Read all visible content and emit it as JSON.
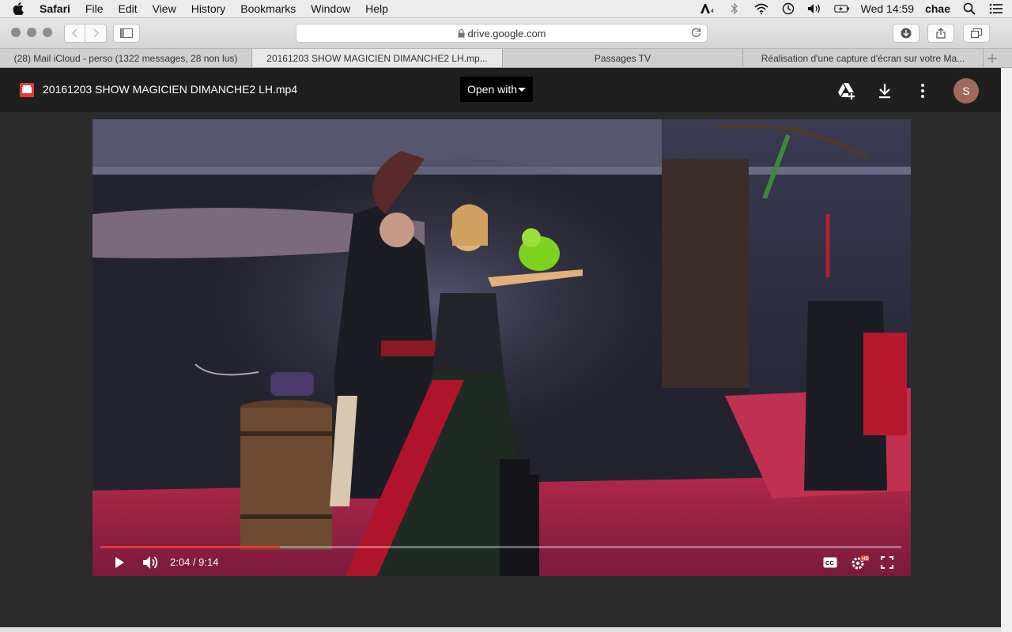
{
  "menubar": {
    "app": "Safari",
    "items": [
      "File",
      "Edit",
      "View",
      "History",
      "Bookmarks",
      "Window",
      "Help"
    ],
    "clock": "Wed 14:59",
    "user": "chae"
  },
  "browser": {
    "url": "drive.google.com",
    "tabs": [
      "(28) Mail iCloud - perso (1322 messages, 28 non lus)",
      "20161203 SHOW MAGICIEN DIMANCHE2 LH.mp...",
      "Passages TV",
      "Réalisation d'une capture d'écran sur votre Ma..."
    ],
    "active_tab": 1
  },
  "viewer": {
    "file_title": "20161203 SHOW MAGICIEN DIMANCHE2 LH.mp4",
    "open_with": "Open with",
    "avatar_letter": "S",
    "avatar_color": "#9e6b5b"
  },
  "video": {
    "time": "2:04 / 9:14",
    "progress": 0.224,
    "progress_color": "#e53935"
  }
}
